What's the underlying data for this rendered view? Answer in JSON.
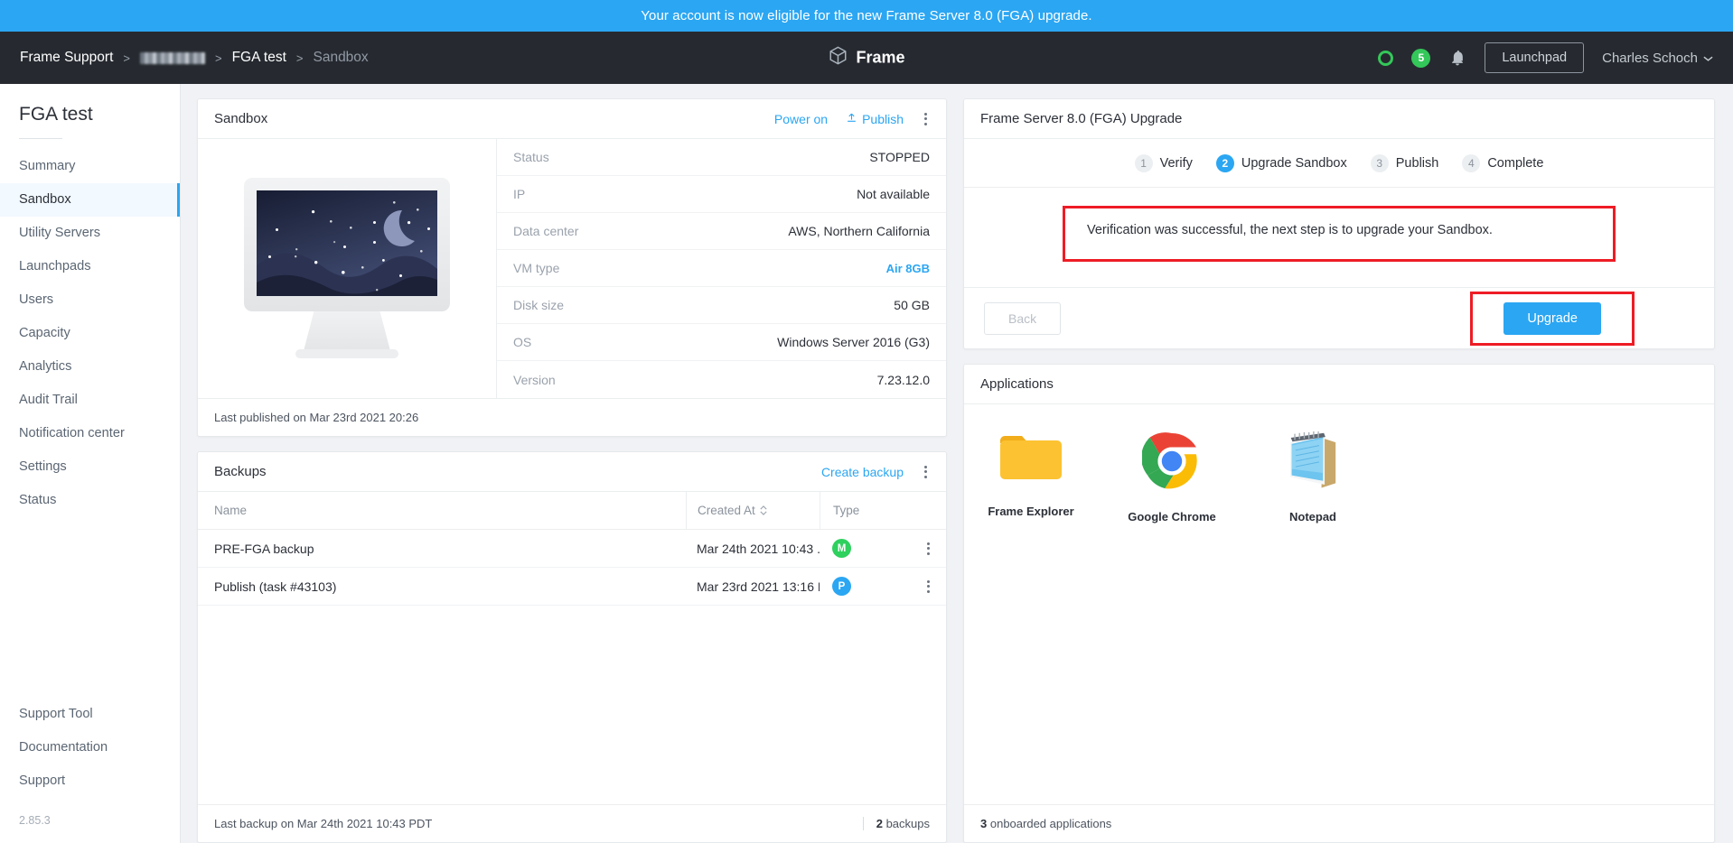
{
  "banner": {
    "text": "Your account is now eligible for the new Frame Server 8.0 (FGA) upgrade."
  },
  "header": {
    "breadcrumb": [
      {
        "label": "Frame Support",
        "redacted": false,
        "current": false
      },
      {
        "label": "",
        "redacted": true,
        "current": false
      },
      {
        "label": "FGA test",
        "redacted": false,
        "current": false
      },
      {
        "label": "Sandbox",
        "redacted": false,
        "current": true
      }
    ],
    "separator": ">",
    "brand": "Frame",
    "brand_icon": "cube-icon",
    "status_icon": "status-ring-icon",
    "notification_count": "5",
    "bell_icon": "bell-icon",
    "launchpad_label": "Launchpad",
    "user_name": "Charles Schoch",
    "chevron_icon": "chevron-down-icon"
  },
  "sidebar": {
    "title": "FGA test",
    "items": [
      {
        "label": "Summary",
        "active": false
      },
      {
        "label": "Sandbox",
        "active": true
      },
      {
        "label": "Utility Servers",
        "active": false
      },
      {
        "label": "Launchpads",
        "active": false
      },
      {
        "label": "Users",
        "active": false
      },
      {
        "label": "Capacity",
        "active": false
      },
      {
        "label": "Analytics",
        "active": false
      },
      {
        "label": "Audit Trail",
        "active": false
      },
      {
        "label": "Notification center",
        "active": false
      },
      {
        "label": "Settings",
        "active": false
      },
      {
        "label": "Status",
        "active": false
      }
    ],
    "bottom_items": [
      {
        "label": "Support Tool"
      },
      {
        "label": "Documentation"
      },
      {
        "label": "Support"
      }
    ],
    "version": "2.85.3"
  },
  "sandbox": {
    "title": "Sandbox",
    "power_on_label": "Power on",
    "publish_label": "Publish",
    "publish_icon": "upload-icon",
    "menu_icon": "kebab-menu-icon",
    "thumbnail_icon": "sleeping-monitor-illustration",
    "details": [
      {
        "label": "Status",
        "value": "STOPPED",
        "link": false
      },
      {
        "label": "IP",
        "value": "Not available",
        "link": false
      },
      {
        "label": "Data center",
        "value": "AWS, Northern California",
        "link": false
      },
      {
        "label": "VM type",
        "value": "Air 8GB",
        "link": true
      },
      {
        "label": "Disk size",
        "value": "50 GB",
        "link": false
      },
      {
        "label": "OS",
        "value": "Windows Server 2016 (G3)",
        "link": false
      },
      {
        "label": "Version",
        "value": "7.23.12.0",
        "link": false
      }
    ],
    "footer": "Last published on Mar 23rd 2021 20:26"
  },
  "backups": {
    "title": "Backups",
    "create_label": "Create backup",
    "menu_icon": "kebab-menu-icon",
    "columns": [
      "Name",
      "Created At",
      "Type"
    ],
    "sort_icon": "sort-arrows-icon",
    "rows": [
      {
        "name": "PRE-FGA backup",
        "created_at": "Mar 24th 2021 10:43 ...",
        "type": "M",
        "type_color": "#2ed05e"
      },
      {
        "name": "Publish (task #43103)",
        "created_at": "Mar 23rd 2021 13:16 P...",
        "type": "P",
        "type_color": "#2ba6f2"
      }
    ],
    "footer_left": "Last backup on Mar 24th 2021 10:43 PDT",
    "footer_count": "2",
    "footer_count_label": "backups"
  },
  "upgrade": {
    "title": "Frame Server 8.0 (FGA) Upgrade",
    "steps": [
      {
        "num": "1",
        "label": "Verify",
        "active": false
      },
      {
        "num": "2",
        "label": "Upgrade Sandbox",
        "active": true
      },
      {
        "num": "3",
        "label": "Publish",
        "active": false
      },
      {
        "num": "4",
        "label": "Complete",
        "active": false
      }
    ],
    "message": "Verification was successful, the next step is to upgrade your Sandbox.",
    "back_label": "Back",
    "upgrade_label": "Upgrade",
    "highlight_color": "#ee1c25"
  },
  "applications": {
    "title": "Applications",
    "items": [
      {
        "name": "Frame Explorer",
        "icon": "folder-icon"
      },
      {
        "name": "Google Chrome",
        "icon": "chrome-icon"
      },
      {
        "name": "Notepad",
        "icon": "notepad-icon"
      }
    ],
    "footer_count": "3",
    "footer_label": "onboarded applications"
  },
  "colors": {
    "accent": "#2ba6f2",
    "header_bg": "#262a30",
    "success": "#34c759",
    "highlight": "#ee1c25"
  }
}
